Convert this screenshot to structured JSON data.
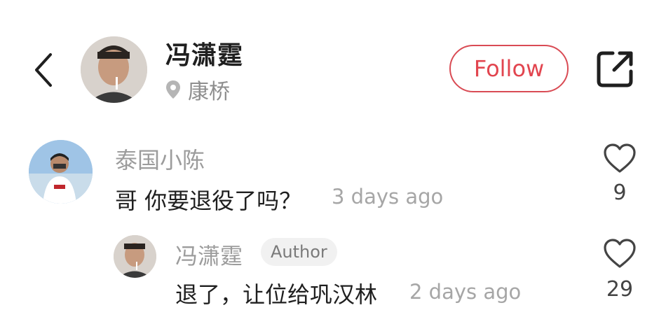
{
  "header": {
    "name": "冯潇霆",
    "location": "康桥",
    "follow_label": "Follow"
  },
  "comments": [
    {
      "username": "泰国小陈",
      "text": "哥 你要退役了吗？",
      "time": "3 days ago",
      "likes": "9"
    },
    {
      "username": "冯潇霆",
      "badge": "Author",
      "text": "退了，让位给巩汉林",
      "time": "2 days ago",
      "likes": "29"
    }
  ],
  "icons": {
    "back": "chevron-left-icon",
    "location": "location-pin-icon",
    "share": "share-external-icon",
    "like": "heart-icon"
  },
  "colors": {
    "accent": "#e2454f",
    "text_primary": "#1f1f1f",
    "text_secondary": "#9c9c9c"
  }
}
